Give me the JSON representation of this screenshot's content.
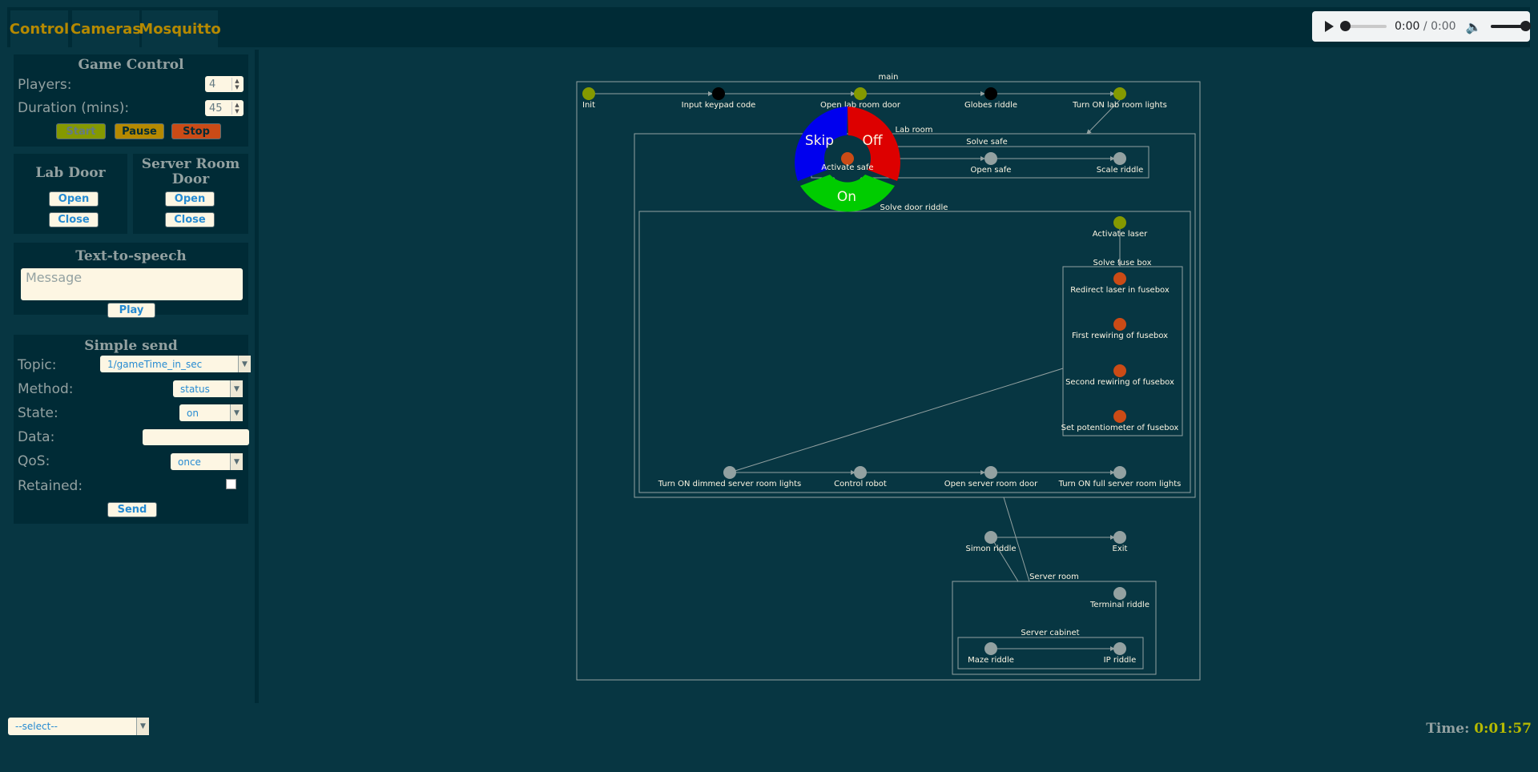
{
  "tabs": [
    "Control",
    "Cameras",
    "Mosquitto"
  ],
  "audio": {
    "current": "0:00",
    "separator": "/",
    "duration": "0:00"
  },
  "game_control": {
    "title": "Game Control",
    "players_label": "Players:",
    "players_value": "4",
    "duration_label": "Duration (mins):",
    "duration_value": "45",
    "start": "Start",
    "pause": "Pause",
    "stop": "Stop",
    "colors": {
      "start": "#859900",
      "pause": "#b58900",
      "stop": "#cb4b16"
    }
  },
  "lab_door": {
    "title": "Lab Door",
    "open": "Open",
    "close": "Close"
  },
  "server_door": {
    "title_line1": "Server Room",
    "title_line2": "Door",
    "open": "Open",
    "close": "Close"
  },
  "tts": {
    "title": "Text-to-speech",
    "placeholder": "Message",
    "play": "Play"
  },
  "simple_send": {
    "title": "Simple send",
    "topic_label": "Topic:",
    "topic_value": "1/gameTime_in_sec",
    "method_label": "Method:",
    "method_value": "status",
    "state_label": "State:",
    "state_value": "on",
    "data_label": "Data:",
    "data_value": "",
    "qos_label": "QoS:",
    "qos_value": "once",
    "retained_label": "Retained:",
    "send": "Send"
  },
  "footer": {
    "select_value": "--select--",
    "time_label": "Time:",
    "time_value": "0:01:57"
  },
  "graph": {
    "node_colors": {
      "active": "#859900",
      "done": "#000000",
      "failed": "#cb4b16",
      "pending": "#93a1a1"
    },
    "clusters": [
      "main",
      "Lab room",
      "Solve safe",
      "Solve door riddle",
      "Solve fuse box",
      "Server room",
      "Server cabinet"
    ],
    "nodes": [
      {
        "label": "Init",
        "state": "active"
      },
      {
        "label": "Input keypad code",
        "state": "done"
      },
      {
        "label": "Open lab room door",
        "state": "active"
      },
      {
        "label": "Globes riddle",
        "state": "done"
      },
      {
        "label": "Turn ON lab room lights",
        "state": "active"
      },
      {
        "label": "Activate safe",
        "state": "failed"
      },
      {
        "label": "Open safe",
        "state": "pending"
      },
      {
        "label": "Scale riddle",
        "state": "pending"
      },
      {
        "label": "Activate laser",
        "state": "active"
      },
      {
        "label": "Redirect laser in fusebox",
        "state": "failed"
      },
      {
        "label": "First rewiring of fusebox",
        "state": "failed"
      },
      {
        "label": "Second rewiring of fusebox",
        "state": "failed"
      },
      {
        "label": "Set potentiometer of fusebox",
        "state": "failed"
      },
      {
        "label": "Turn ON dimmed server room lights",
        "state": "pending"
      },
      {
        "label": "Control robot",
        "state": "pending"
      },
      {
        "label": "Open server room door",
        "state": "pending"
      },
      {
        "label": "Turn ON full server room lights",
        "state": "pending"
      },
      {
        "label": "Simon riddle",
        "state": "pending"
      },
      {
        "label": "Exit",
        "state": "pending"
      },
      {
        "label": "Terminal riddle",
        "state": "pending"
      },
      {
        "label": "Maze riddle",
        "state": "pending"
      },
      {
        "label": "IP riddle",
        "state": "pending"
      }
    ],
    "radial_menu": {
      "skip": "Skip",
      "off": "Off",
      "on": "On",
      "colors": {
        "skip": "#0000ee",
        "off": "#dd0000",
        "on": "#00cc00"
      }
    }
  }
}
